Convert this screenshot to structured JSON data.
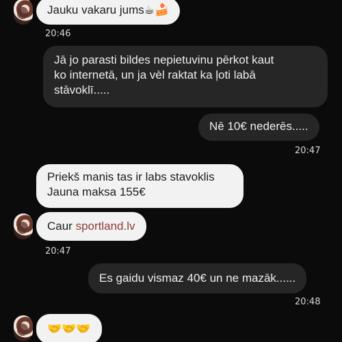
{
  "messages": [
    {
      "id": "m1",
      "direction": "incoming",
      "text": "Jauku vakaru jums☕🍰",
      "time": "20:46"
    },
    {
      "id": "m2",
      "direction": "outgoing",
      "lines": [
        "Jā jo parasti bildes nepietuvinu pērkot kaut",
        "ko internetā, un ja vèl raktat ka ļoti labā",
        "stāvoklī....."
      ]
    },
    {
      "id": "m3",
      "direction": "outgoing",
      "text": "Nē 10€ nederēs.....",
      "time": "20:47"
    },
    {
      "id": "m4",
      "direction": "incoming",
      "lines": [
        "Priekš manis tas ir labs stavoklis",
        "Jauna maksa 155€"
      ]
    },
    {
      "id": "m5",
      "direction": "incoming",
      "prefix": "Caur ",
      "link": "sportland.lv",
      "time": "20:47"
    },
    {
      "id": "m6",
      "direction": "outgoing",
      "text": "Es gaidu vismaz 40€ un ne mazāk......",
      "time": "20:48"
    },
    {
      "id": "m7",
      "direction": "incoming",
      "text": "🤝🤝🤝"
    }
  ],
  "colors": {
    "background": "#0b0b0b",
    "incoming_bubble": "#f2f2f2",
    "outgoing_bubble": "#262626",
    "link": "#8d3d38"
  }
}
